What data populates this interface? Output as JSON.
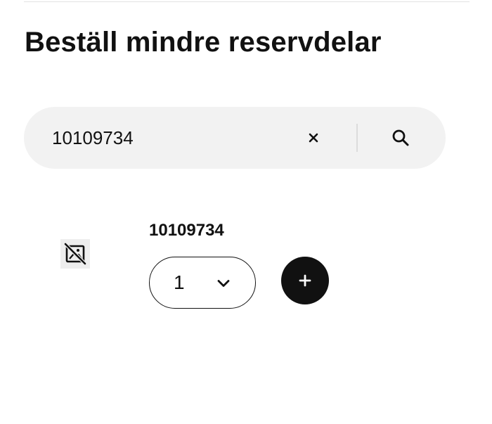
{
  "page": {
    "title": "Beställ mindre reservdelar"
  },
  "search": {
    "value": "10109734",
    "clear_icon": "close-icon",
    "search_icon": "search-icon"
  },
  "result": {
    "image_icon": "image-unavailable-icon",
    "product_number": "10109734",
    "quantity": "1",
    "quantity_icon": "chevron-down-icon",
    "add_icon": "plus-icon"
  }
}
